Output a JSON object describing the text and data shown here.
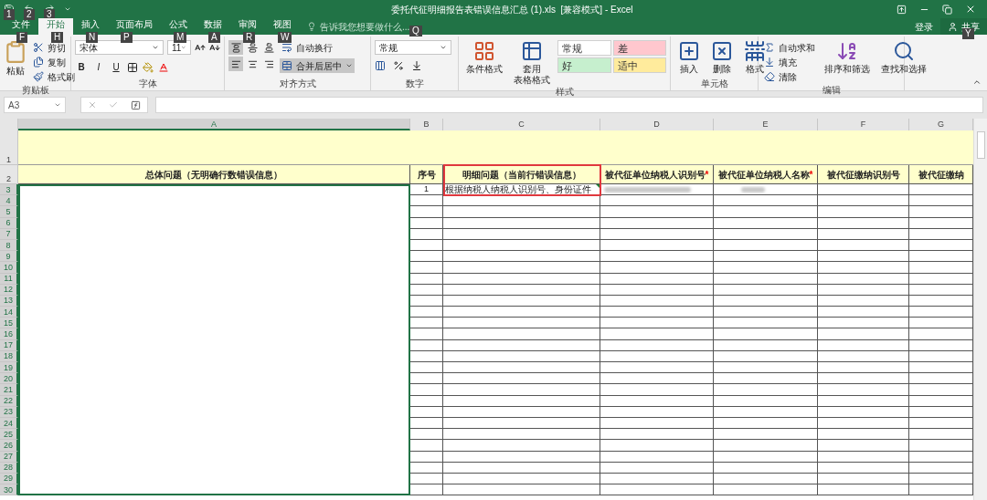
{
  "window": {
    "title": "委托代征明细报告表错误信息汇总 (1).xls  [兼容模式] - Excel",
    "quick_access_keytips": [
      "1",
      "2",
      "3"
    ]
  },
  "tabs": [
    {
      "label": "文件",
      "keytip": "F",
      "selected": false
    },
    {
      "label": "开始",
      "keytip": "H",
      "selected": true
    },
    {
      "label": "插入",
      "keytip": "N",
      "selected": false
    },
    {
      "label": "页面布局",
      "keytip": "P",
      "selected": false
    },
    {
      "label": "公式",
      "keytip": "M",
      "selected": false
    },
    {
      "label": "数据",
      "keytip": "A",
      "selected": false
    },
    {
      "label": "审阅",
      "keytip": "R",
      "selected": false
    },
    {
      "label": "视图",
      "keytip": "W",
      "selected": false
    }
  ],
  "tell_me": {
    "placeholder": "告诉我您想要做什么...",
    "keytip": "Q"
  },
  "account": {
    "sign_in": "登录",
    "share": "共享",
    "share_keytip": "Y"
  },
  "ribbon": [
    {
      "kind": "clipboard",
      "label": "剪贴板",
      "paste": "粘贴",
      "items": [
        "剪切",
        "复制",
        "格式刷"
      ]
    },
    {
      "kind": "font",
      "label": "字体",
      "font_name": "宋体",
      "font_size": "11",
      "styles": [
        "B",
        "I",
        "U"
      ]
    },
    {
      "kind": "alignment",
      "label": "对齐方式",
      "wrap": "自动换行",
      "merge": "合并后居中",
      "merge_on": true,
      "align_buttons": [
        {
          "kind": "top",
          "on": true
        },
        {
          "kind": "middle",
          "on": false
        },
        {
          "kind": "bottom",
          "on": false
        },
        {
          "kind": "left",
          "on": true
        },
        {
          "kind": "center",
          "on": false
        },
        {
          "kind": "right",
          "on": false
        }
      ]
    },
    {
      "kind": "number",
      "label": "数字",
      "format": "常规"
    },
    {
      "kind": "styles",
      "label": "样式",
      "conditional": "条件格式",
      "table": [
        "套用",
        "表格格式"
      ],
      "cell_styles": [
        {
          "label": "常规",
          "color": "#ffffff"
        },
        {
          "label": "差",
          "color": "#ffc7ce"
        },
        {
          "label": "好",
          "color": "#c6efce"
        },
        {
          "label": "适中",
          "color": "#ffeb9c"
        }
      ]
    },
    {
      "kind": "cells",
      "label": "单元格",
      "buttons": [
        "插入",
        "删除",
        "格式"
      ]
    },
    {
      "kind": "editing",
      "label": "编辑",
      "items": [
        "自动求和",
        "填充",
        "清除"
      ],
      "buttons": [
        "排序和筛选",
        "查找和选择"
      ]
    }
  ],
  "formula_bar": {
    "name_box": "A3"
  },
  "sheet": {
    "columns": [
      {
        "label": "A",
        "selected": true
      },
      {
        "label": "B",
        "selected": false
      },
      {
        "label": "C",
        "selected": false
      },
      {
        "label": "D",
        "selected": false
      },
      {
        "label": "E",
        "selected": false
      },
      {
        "label": "F",
        "selected": false
      },
      {
        "label": "G",
        "selected": false
      }
    ],
    "rows": [
      {
        "label": "1",
        "selected": false
      },
      {
        "label": "2",
        "selected": false
      },
      {
        "label": "3",
        "selected": true
      },
      {
        "label": "4",
        "selected": true
      },
      {
        "label": "5",
        "selected": true
      },
      {
        "label": "6",
        "selected": true
      },
      {
        "label": "7",
        "selected": true
      },
      {
        "label": "8",
        "selected": true
      },
      {
        "label": "9",
        "selected": true
      },
      {
        "label": "10",
        "selected": true
      },
      {
        "label": "11",
        "selected": true
      },
      {
        "label": "12",
        "selected": true
      },
      {
        "label": "13",
        "selected": true
      },
      {
        "label": "14",
        "selected": true
      },
      {
        "label": "15",
        "selected": true
      },
      {
        "label": "16",
        "selected": true
      },
      {
        "label": "17",
        "selected": true
      },
      {
        "label": "18",
        "selected": true
      },
      {
        "label": "19",
        "selected": true
      },
      {
        "label": "20",
        "selected": true
      },
      {
        "label": "21",
        "selected": true
      },
      {
        "label": "22",
        "selected": true
      },
      {
        "label": "23",
        "selected": true
      },
      {
        "label": "24",
        "selected": true
      },
      {
        "label": "25",
        "selected": true
      },
      {
        "label": "26",
        "selected": true
      },
      {
        "label": "27",
        "selected": true
      },
      {
        "label": "28",
        "selected": true
      },
      {
        "label": "29",
        "selected": true
      },
      {
        "label": "30",
        "selected": true
      }
    ],
    "header_cells": [
      {
        "text": "总体问题（无明确行数错误信息）",
        "required": false
      },
      {
        "text": "序号",
        "required": false
      },
      {
        "text": "明细问题（当前行错误信息）",
        "required": false
      },
      {
        "text": "被代征单位纳税人识别号",
        "required": true
      },
      {
        "text": "被代征单位纳税人名称",
        "required": true
      },
      {
        "text": "被代征缴纳识别号",
        "required": false
      },
      {
        "text": "被代征缴纳",
        "required": false
      }
    ],
    "required_mark": "*",
    "first_row": {
      "seq": "1",
      "detail": "根据纳税人纳税人识别号、身份证件"
    }
  }
}
